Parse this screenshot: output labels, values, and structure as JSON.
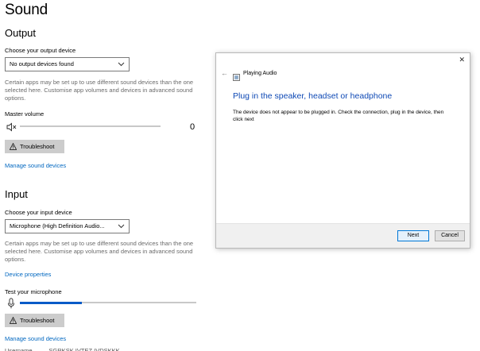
{
  "page": {
    "title": "Sound",
    "output": {
      "heading": "Output",
      "device_label": "Choose your output device",
      "device_value": "No output devices found",
      "help_text": "Certain apps may be set up to use different sound devices than the one selected here. Customise app volumes and devices in advanced sound options.",
      "master_volume_label": "Master volume",
      "master_volume_value": "0",
      "troubleshoot_label": "Troubleshoot",
      "manage_link": "Manage sound devices"
    },
    "input": {
      "heading": "Input",
      "device_label": "Choose your input device",
      "device_value": "Microphone (High Definition Audio...",
      "help_text": "Certain apps may be set up to use different sound devices than the one selected here. Customise app volumes and devices in advanced sound options.",
      "device_properties_link": "Device properties",
      "test_label": "Test your microphone",
      "mic_level_fraction": 0.35,
      "troubleshoot_label": "Troubleshoot",
      "manage_link": "Manage sound devices"
    },
    "footer_cut_text": "Username          SGRKSK IVTEZ IVDSKKK"
  },
  "dialog": {
    "title": "Playing Audio",
    "heading": "Plug in the speaker, headset or headphone",
    "body": "The device does not appear to be plugged in. Check the connection, plug in the device, then click next",
    "next_label": "Next",
    "cancel_label": "Cancel",
    "close_glyph": "✕",
    "back_glyph": "←"
  },
  "colors": {
    "accent": "#0067c0",
    "slider_fill": "#0a5bc7",
    "button_bg": "#cccccc"
  },
  "icons": [
    "speaker-muted-icon",
    "warning-icon",
    "microphone-icon",
    "chevron-down-icon",
    "back-arrow-icon",
    "close-icon",
    "troubleshooter-app-icon"
  ]
}
